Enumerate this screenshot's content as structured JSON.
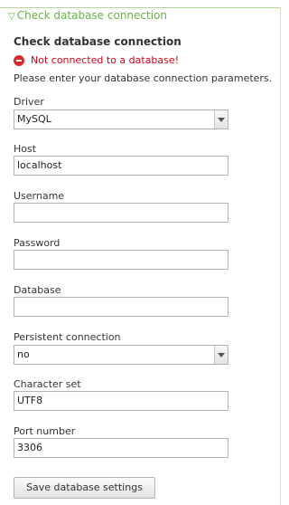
{
  "legend": {
    "label": "Check database connection"
  },
  "title": "Check database connection",
  "error": "Not connected to a database!",
  "intro": "Please enter your database connection parameters.",
  "fields": {
    "driver": {
      "label": "Driver",
      "value": "MySQL"
    },
    "host": {
      "label": "Host",
      "value": "localhost"
    },
    "username": {
      "label": "Username",
      "value": ""
    },
    "password": {
      "label": "Password",
      "value": ""
    },
    "database": {
      "label": "Database",
      "value": ""
    },
    "persistent": {
      "label": "Persistent connection",
      "value": "no"
    },
    "charset": {
      "label": "Character set",
      "value": "UTF8"
    },
    "port": {
      "label": "Port number",
      "value": "3306"
    }
  },
  "save_button": "Save database settings",
  "icons": {
    "legend": "triangle-down-icon",
    "error": "error-icon"
  },
  "colors": {
    "legend": "#6bb04a",
    "error": "#d0021b"
  }
}
